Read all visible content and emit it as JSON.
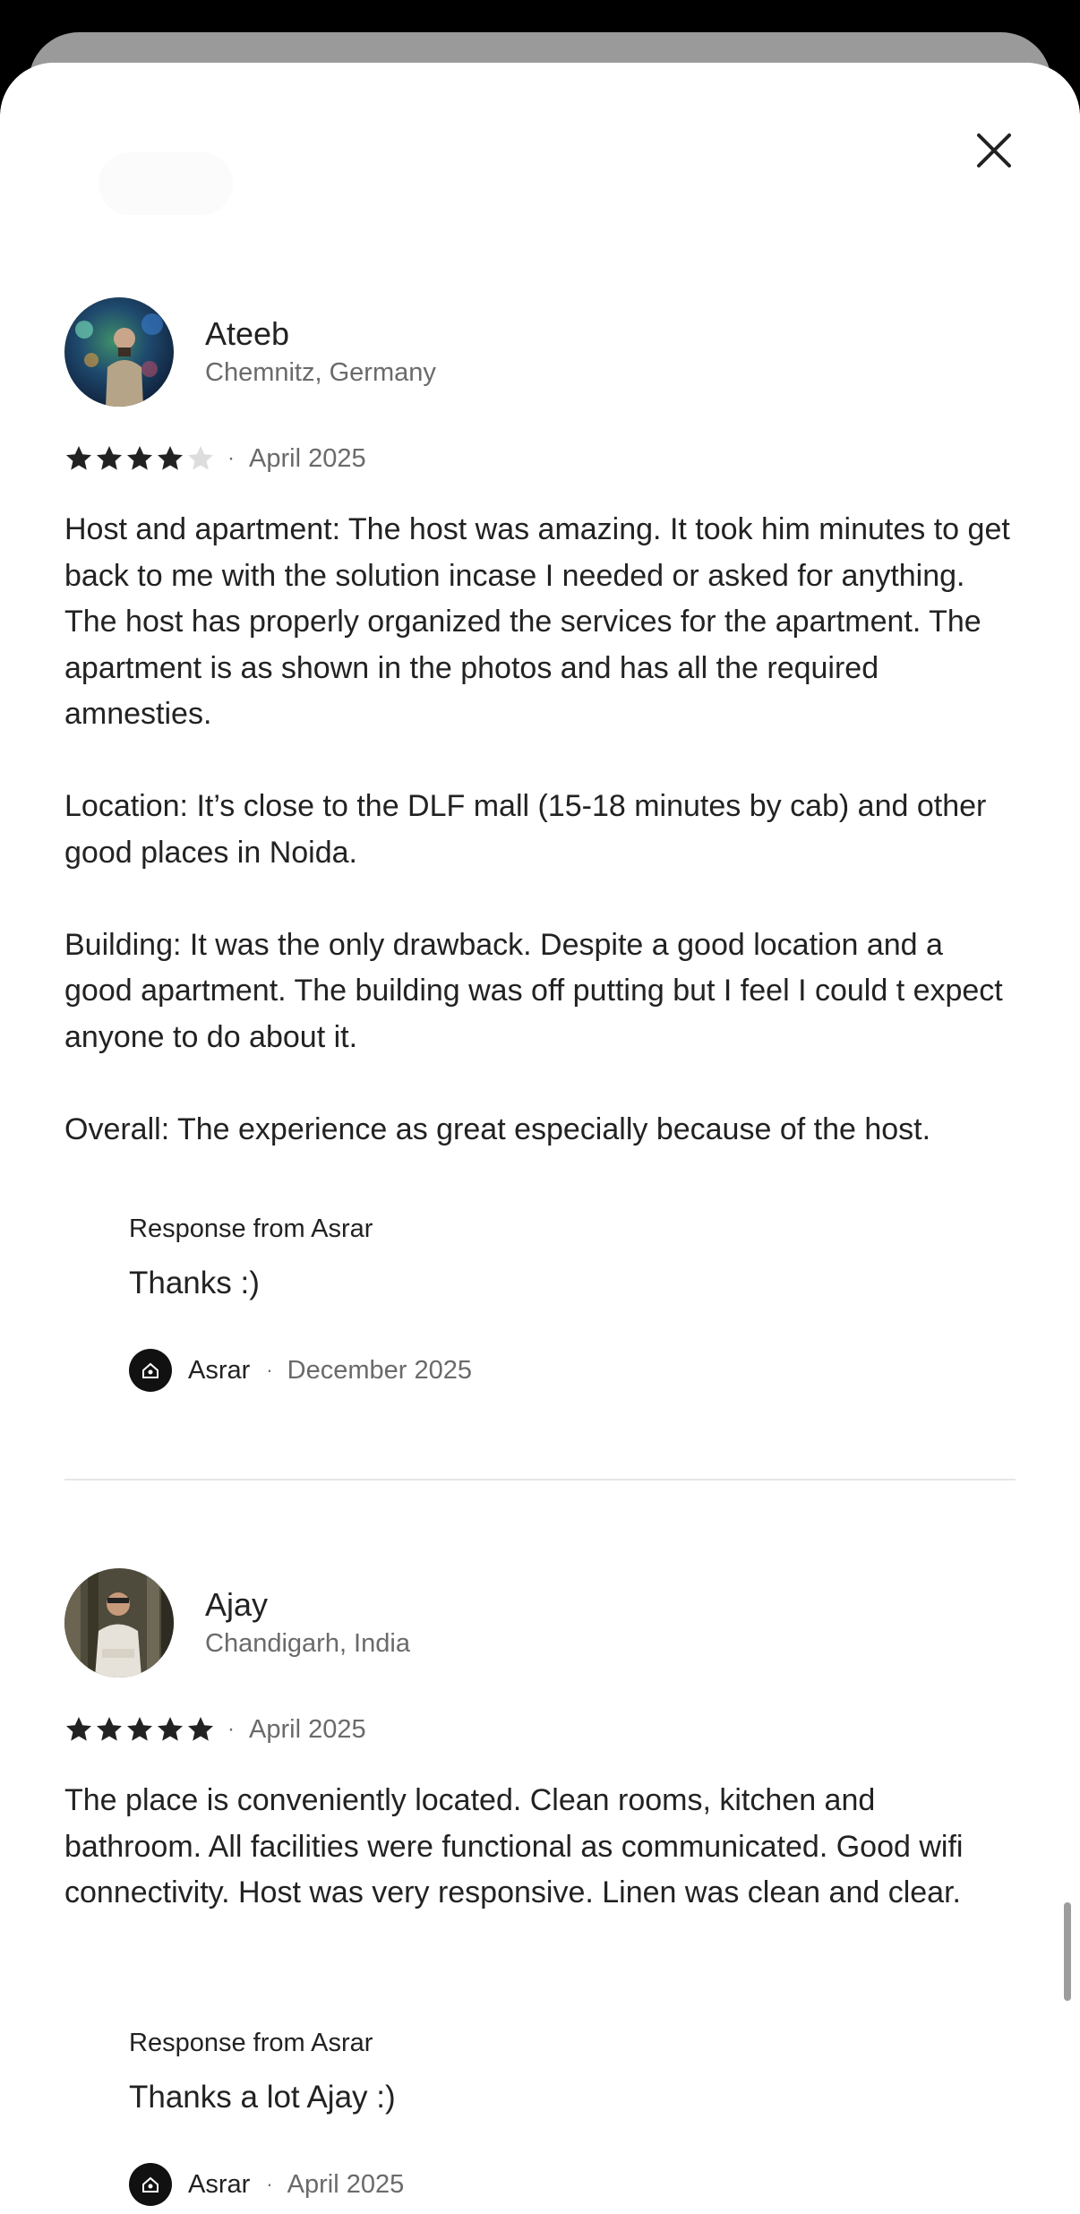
{
  "modal": {
    "close_icon": "close-icon"
  },
  "reviews": [
    {
      "name": "Ateeb",
      "location": "Chemnitz, Germany",
      "rating": 4,
      "max_rating": 5,
      "date": "April 2025",
      "body": "Host and apartment: The host was amazing. It took him minutes to get back to me with the solution incase I needed or asked for anything. The host has properly organized the services for the apartment. The apartment is as shown in the photos and has all the required amnesties.\n\nLocation: It’s close to the DLF mall (15-18 minutes by cab) and other good places in Noida.\n\nBuilding: It was the only drawback. Despite a good location and a good apartment. The building was off putting but I feel I could t expect anyone to do about it.\n\nOverall: The experience as great especially because of the host.",
      "response": {
        "title": "Response from Asrar",
        "text": "Thanks :)",
        "host_name": "Asrar",
        "date": "December 2025"
      }
    },
    {
      "name": "Ajay",
      "location": "Chandigarh, India",
      "rating": 5,
      "max_rating": 5,
      "date": "April 2025",
      "body": "The place is conveniently located. Clean rooms, kitchen and bathroom. All facilities were functional as communicated. Good wifi connectivity. Host was very responsive. Linen was clean and clear.",
      "response": {
        "title": "Response from Asrar",
        "text": "Thanks a lot Ajay :)",
        "host_name": "Asrar",
        "date": "April 2025"
      }
    }
  ],
  "colors": {
    "text": "#222222",
    "muted": "#6a6a6a",
    "star_filled": "#222222",
    "star_empty": "#dddddd",
    "divider": "#e6e6e6"
  }
}
